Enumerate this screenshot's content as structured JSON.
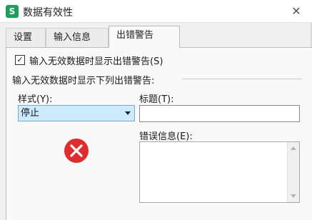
{
  "window": {
    "app_icon_letter": "S",
    "title": "数据有效性",
    "close_glyph": "✕"
  },
  "tabs": [
    {
      "label": "设置",
      "active": false
    },
    {
      "label": "输入信息",
      "active": false
    },
    {
      "label": "出错警告",
      "active": true
    }
  ],
  "error_alert": {
    "show_alert_checkbox": {
      "label": "输入无效数据时显示出错警告(S)",
      "checked": true,
      "glyph": "✓"
    },
    "section_label": "输入无效数据时显示下列出错警告:",
    "style": {
      "label": "样式(Y):",
      "selected": "停止"
    },
    "title_field": {
      "label": "标题(T):",
      "value": ""
    },
    "message_field": {
      "label": "错误信息(E):",
      "value": ""
    },
    "icon": "error-stop-icon",
    "colors": {
      "error_icon": "#e02c2c",
      "select_bg": "#ccebff",
      "app_icon": "#1e9e5a"
    }
  }
}
